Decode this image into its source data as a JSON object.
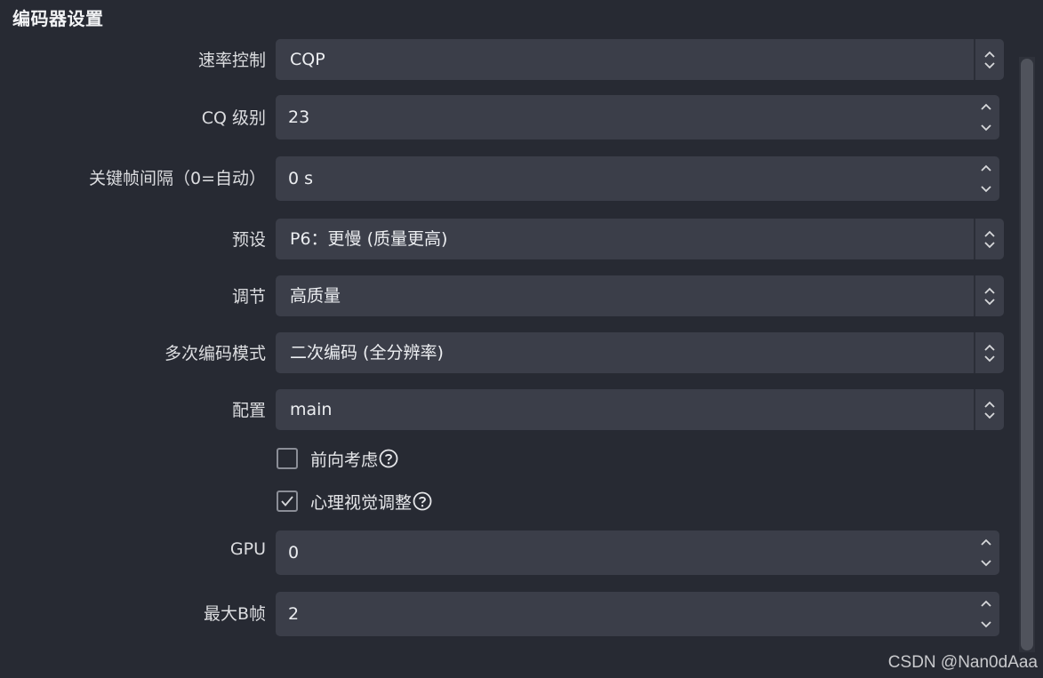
{
  "section_title": "编码器设置",
  "rows": {
    "rate_control": {
      "label": "速率控制",
      "value": "CQP"
    },
    "cq_level": {
      "label": "CQ 级别",
      "value": "23"
    },
    "keyframe_interval": {
      "label": "关键帧间隔（0=自动）",
      "value": "0 s"
    },
    "preset": {
      "label": "预设",
      "value": "P6：更慢 (质量更高)"
    },
    "tuning": {
      "label": "调节",
      "value": "高质量"
    },
    "multipass": {
      "label": "多次编码模式",
      "value": "二次编码 (全分辨率)"
    },
    "profile": {
      "label": "配置",
      "value": "main"
    },
    "gpu": {
      "label": "GPU",
      "value": "0"
    },
    "max_bframes": {
      "label": "最大B帧",
      "value": "2"
    }
  },
  "checkboxes": {
    "lookahead": {
      "label": "前向考虑",
      "checked": false
    },
    "psycho_visual": {
      "label": "心理视觉调整",
      "checked": true
    }
  },
  "watermark": "CSDN @Nan0dAaa"
}
